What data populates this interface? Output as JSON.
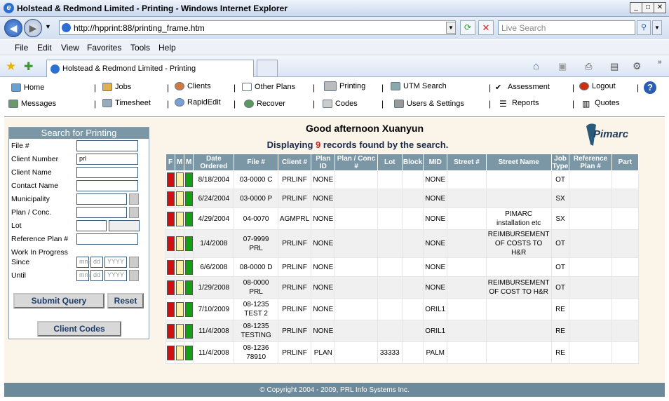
{
  "window": {
    "title": "Holstead & Redmond Limited - Printing - Windows Internet Explorer"
  },
  "browser": {
    "url": "http://hpprint:88/printing_frame.htm",
    "search_placeholder": "Live Search",
    "tab_label": "Holstead & Redmond Limited - Printing",
    "menu": [
      "File",
      "Edit",
      "View",
      "Favorites",
      "Tools",
      "Help"
    ]
  },
  "nav": {
    "row1": [
      {
        "label": "Home",
        "icon": "home-icon"
      },
      {
        "label": "Jobs",
        "icon": "jobs-icon"
      },
      {
        "label": "Clients",
        "icon": "clients-icon"
      },
      {
        "label": "Other Plans",
        "icon": "other-plans-icon"
      },
      {
        "label": "Printing",
        "icon": "printer-icon"
      },
      {
        "label": "UTM Search",
        "icon": "utm-search-icon"
      },
      {
        "label": "Assessment",
        "icon": "assessment-icon"
      },
      {
        "label": "Logout",
        "icon": "logout-icon"
      }
    ],
    "row2": [
      {
        "label": "Messages",
        "icon": "messages-icon"
      },
      {
        "label": "Timesheet",
        "icon": "timesheet-icon"
      },
      {
        "label": "RapidEdit",
        "icon": "rapidedit-icon"
      },
      {
        "label": "Recover",
        "icon": "recover-icon"
      },
      {
        "label": "Codes",
        "icon": "codes-icon"
      },
      {
        "label": "Users & Settings",
        "icon": "users-settings-icon"
      },
      {
        "label": "Reports",
        "icon": "reports-icon"
      },
      {
        "label": "Quotes",
        "icon": "quotes-icon"
      }
    ]
  },
  "search": {
    "title": "Search for Printing",
    "fields": [
      {
        "label": "File #",
        "value": ""
      },
      {
        "label": "Client Number",
        "value": "prl"
      },
      {
        "label": "Client Name",
        "value": ""
      },
      {
        "label": "Contact Name",
        "value": ""
      },
      {
        "label": "Municipality",
        "value": ""
      },
      {
        "label": "Plan / Conc.",
        "value": ""
      },
      {
        "label": "Lot",
        "value": ""
      },
      {
        "label": "Reference Plan #",
        "value": ""
      }
    ],
    "wip_label": "Work In Progress",
    "since_label": "Since",
    "until_label": "Until",
    "date_placeholders": [
      "mm",
      "dd",
      "YYYY"
    ],
    "submit": "Submit Query",
    "reset": "Reset",
    "client_codes": "Client Codes"
  },
  "greeting": "Good afternoon Xuanyun",
  "records": {
    "prefix": "Displaying",
    "count": "9",
    "suffix": "records found by the search."
  },
  "logo_text": "Pimarc",
  "table": {
    "headers": [
      "F",
      "M",
      "M",
      "Date Ordered",
      "File #",
      "Client #",
      "Plan ID",
      "Plan / Conc #",
      "Lot",
      "Block",
      "MID",
      "Street #",
      "Street Name",
      "Job Type",
      "Reference Plan #",
      "Part"
    ],
    "rows": [
      [
        "8/18/2004",
        "03-0000 C",
        "PRLINF",
        "NONE",
        "",
        "",
        "",
        "NONE",
        "",
        "",
        "OT",
        "",
        ""
      ],
      [
        "6/24/2004",
        "03-0000 P",
        "PRLINF",
        "NONE",
        "",
        "",
        "",
        "NONE",
        "",
        "",
        "SX",
        "",
        ""
      ],
      [
        "4/29/2004",
        "04-0070",
        "AGMPRL",
        "NONE",
        "",
        "",
        "",
        "NONE",
        "",
        "PIMARC installation etc",
        "SX",
        "",
        ""
      ],
      [
        "1/4/2008",
        "07-9999 PRL",
        "PRLINF",
        "NONE",
        "",
        "",
        "",
        "NONE",
        "",
        "REIMBURSEMENT OF COSTS TO H&R",
        "OT",
        "",
        ""
      ],
      [
        "6/6/2008",
        "08-0000 D",
        "PRLINF",
        "NONE",
        "",
        "",
        "",
        "NONE",
        "",
        "",
        "OT",
        "",
        ""
      ],
      [
        "1/29/2008",
        "08-0000 PRL",
        "PRLINF",
        "NONE",
        "",
        "",
        "",
        "NONE",
        "",
        "REIMBURSEMENT OF COST TO H&R",
        "OT",
        "",
        ""
      ],
      [
        "7/10/2009",
        "08-1235 TEST 2",
        "PRLINF",
        "NONE",
        "",
        "",
        "",
        "ORIL1",
        "",
        "",
        "RE",
        "",
        ""
      ],
      [
        "11/4/2008",
        "08-1235 TESTING",
        "PRLINF",
        "NONE",
        "",
        "",
        "",
        "ORIL1",
        "",
        "",
        "RE",
        "",
        ""
      ],
      [
        "11/4/2008",
        "08-1236 78910",
        "PRLINF",
        "PLAN",
        "",
        "33333",
        "",
        "PALM",
        "",
        "",
        "RE",
        "",
        ""
      ]
    ]
  },
  "footer": "© Copyright 2004 - 2009, PRL Info Systems Inc."
}
